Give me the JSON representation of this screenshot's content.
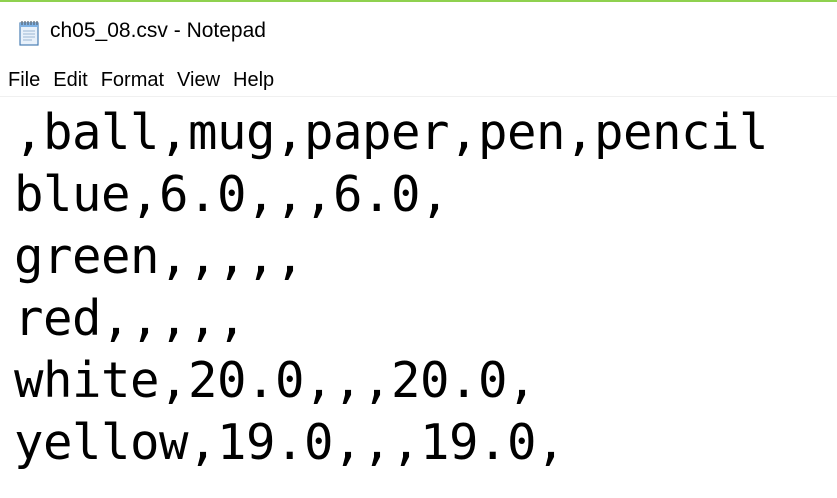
{
  "window": {
    "title": "ch05_08.csv - Notepad",
    "icon": "notepad-icon",
    "accent_color": "#8fd14f"
  },
  "menubar": {
    "items": [
      {
        "label": "File"
      },
      {
        "label": "Edit"
      },
      {
        "label": "Format"
      },
      {
        "label": "View"
      },
      {
        "label": "Help"
      }
    ]
  },
  "editor": {
    "lines": [
      ",ball,mug,paper,pen,pencil",
      "blue,6.0,,,6.0,",
      "green,,,,,",
      "red,,,,,",
      "white,20.0,,,20.0,",
      "yellow,19.0,,,19.0,"
    ]
  }
}
